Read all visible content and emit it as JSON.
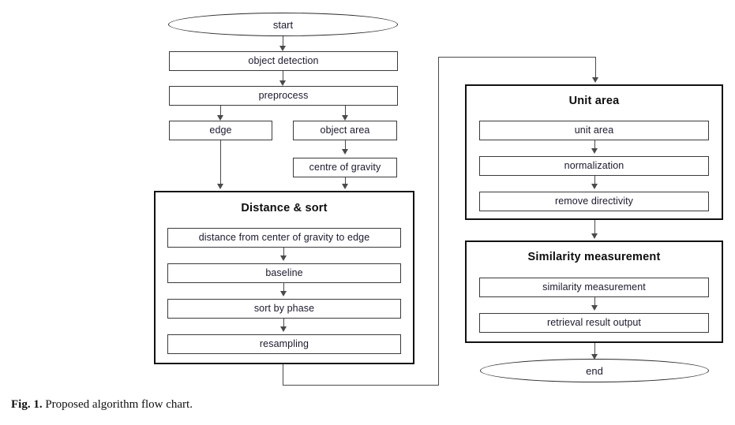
{
  "figure": {
    "caption_label": "Fig. 1.",
    "caption_text": "Proposed algorithm flow chart.",
    "colors": {
      "node_border": "#3a3a3a",
      "group_border": "#111111",
      "connector": "#4a4a4a",
      "text": "#1a1a2e",
      "background": "#ffffff"
    }
  },
  "flow": {
    "start": "start",
    "end": "end",
    "main_steps": [
      {
        "label": "object detection"
      },
      {
        "label": "preprocess"
      },
      {
        "label": "edge"
      },
      {
        "label": "object area"
      },
      {
        "label": "centre of gravity"
      }
    ],
    "groups": [
      {
        "title": "Distance & sort",
        "steps": [
          "distance from center of gravity to edge",
          "baseline",
          "sort by phase",
          "resampling"
        ]
      },
      {
        "title": "Unit area",
        "steps": [
          "unit area",
          "normalization",
          "remove directivity"
        ]
      },
      {
        "title": "Similarity measurement",
        "steps": [
          "similarity measurement",
          "retrieval result output"
        ]
      }
    ]
  }
}
